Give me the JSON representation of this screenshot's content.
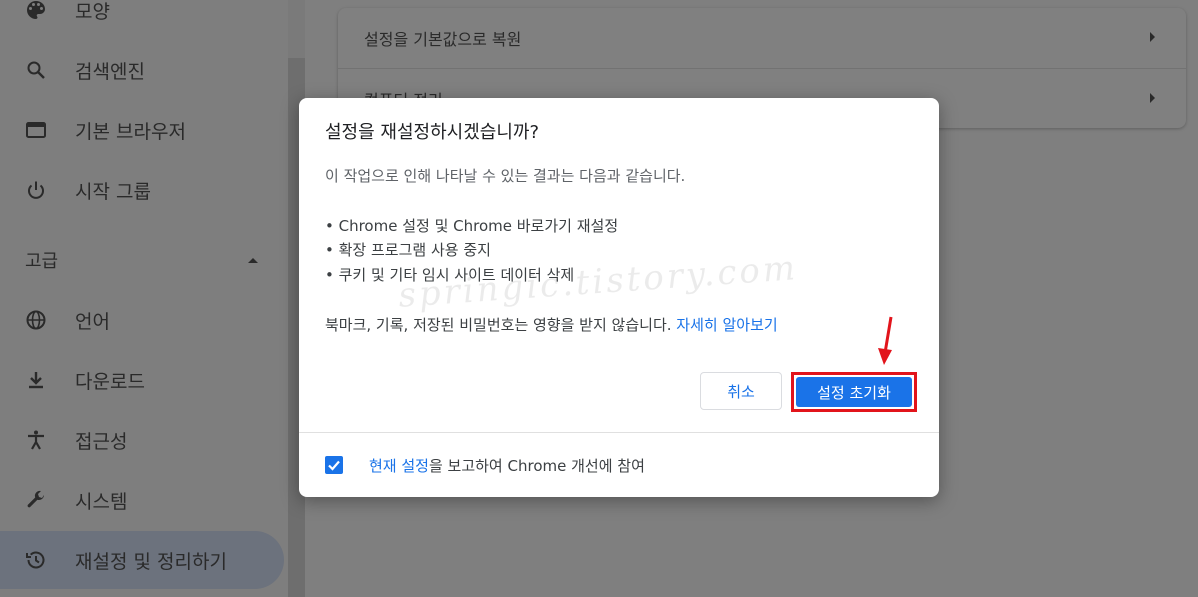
{
  "sidebar": {
    "items": [
      {
        "label": "모양",
        "icon": "palette-icon"
      },
      {
        "label": "검색엔진",
        "icon": "search-icon"
      },
      {
        "label": "기본 브라우저",
        "icon": "browser-icon"
      },
      {
        "label": "시작 그룹",
        "icon": "power-icon"
      }
    ],
    "advanced_label": "고급",
    "advanced_items": [
      {
        "label": "언어",
        "icon": "globe-icon"
      },
      {
        "label": "다운로드",
        "icon": "download-icon"
      },
      {
        "label": "접근성",
        "icon": "accessibility-icon"
      },
      {
        "label": "시스템",
        "icon": "wrench-icon"
      },
      {
        "label": "재설정 및 정리하기",
        "icon": "history-icon"
      }
    ]
  },
  "main": {
    "rows": [
      {
        "label": "설정을 기본값으로 복원"
      },
      {
        "label": "컴퓨터 정리"
      }
    ]
  },
  "dialog": {
    "title": "설정을 재설정하시겠습니까?",
    "intro": "이 작업으로 인해 나타날 수 있는 결과는 다음과 같습니다.",
    "bullets": [
      "• Chrome 설정 및 Chrome 바로가기 재설정",
      "• 확장 프로그램 사용 중지",
      "• 쿠키 및 기타 임시 사이트 데이터 삭제"
    ],
    "note": "북마크, 기록, 저장된 비밀번호는 영향을 받지 않습니다.",
    "learn_more": "자세히 알아보기",
    "cancel_label": "취소",
    "reset_label": "설정 초기화",
    "report_link": "현재 설정",
    "report_text": "을 보고하여 Chrome 개선에 참여",
    "report_checked": true
  },
  "watermark": "springic.tistory.com",
  "colors": {
    "accent": "#1a73e8",
    "highlight": "#e2141b"
  }
}
